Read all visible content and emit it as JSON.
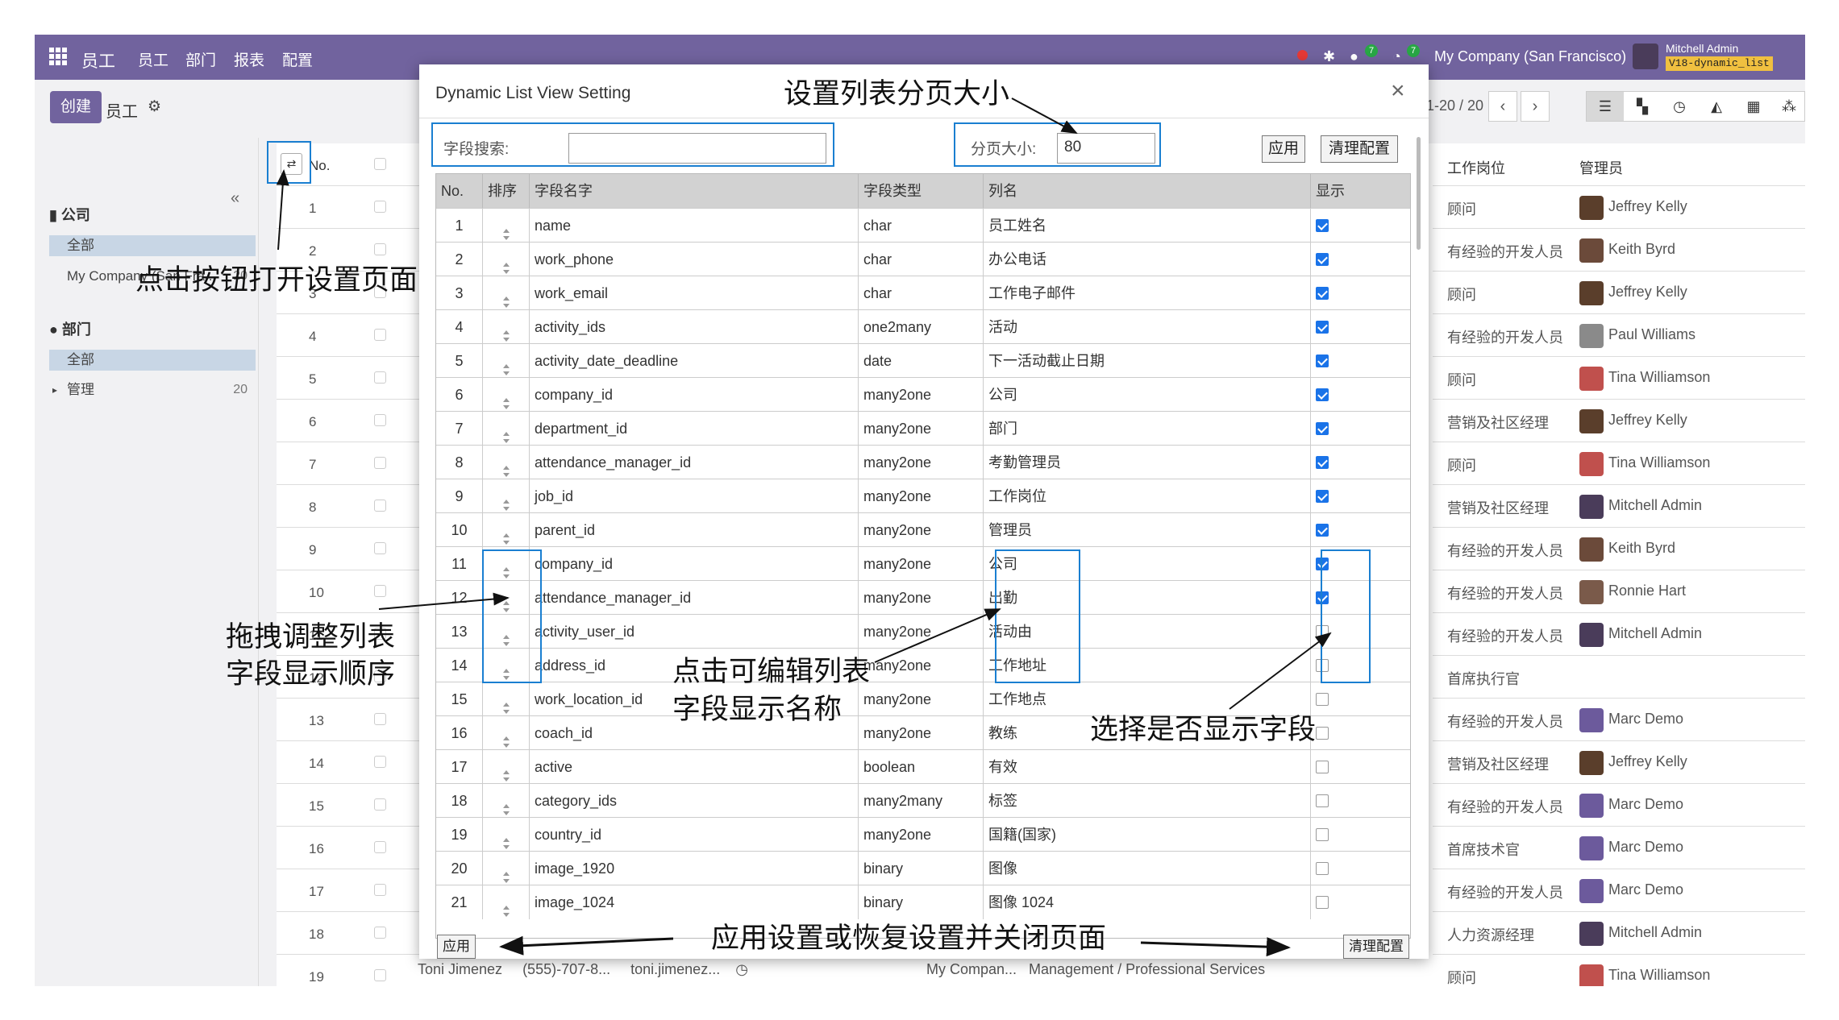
{
  "navbar": {
    "app_title": "员工",
    "menus": [
      "员工",
      "部门",
      "报表",
      "配置"
    ],
    "chat_badge": "7",
    "activity_badge": "7",
    "company": "My Company (San Francisco)",
    "user": "Mitchell Admin",
    "db": "V18-dynamic_list"
  },
  "control_panel": {
    "create_label": "创建",
    "breadcrumb": "员工",
    "pager": "1-20 / 20"
  },
  "sidepanel": {
    "company_head": "公司",
    "company_all": "全部",
    "company_item": "My Company (San Fra...",
    "company_count": "20",
    "dept_head": "部门",
    "dept_all": "全部",
    "dept_item": "管理",
    "dept_count": "20"
  },
  "list": {
    "no_header": "No.",
    "job_header": "工作岗位",
    "manager_header": "管理员",
    "row_numbers": [
      "1",
      "2",
      "3",
      "4",
      "5",
      "6",
      "7",
      "8",
      "9",
      "10",
      "11",
      "12",
      "13",
      "14",
      "15",
      "16",
      "17",
      "18",
      "19"
    ],
    "right_rows": [
      {
        "job": "顾问",
        "manager": "Jeffrey Kelly",
        "color": "#5a3e2b"
      },
      {
        "job": "有经验的开发人员",
        "manager": "Keith Byrd",
        "color": "#6b4a3a"
      },
      {
        "job": "顾问",
        "manager": "Jeffrey Kelly",
        "color": "#5a3e2b"
      },
      {
        "job": "有经验的开发人员",
        "manager": "Paul Williams",
        "color": "#8a8a8a"
      },
      {
        "job": "顾问",
        "manager": "Tina Williamson",
        "color": "#c0504d"
      },
      {
        "job": "营销及社区经理",
        "manager": "Jeffrey Kelly",
        "color": "#5a3e2b"
      },
      {
        "job": "顾问",
        "manager": "Tina Williamson",
        "color": "#c0504d"
      },
      {
        "job": "营销及社区经理",
        "manager": "Mitchell Admin",
        "color": "#4a3c5a"
      },
      {
        "job": "有经验的开发人员",
        "manager": "Keith Byrd",
        "color": "#6b4a3a"
      },
      {
        "job": "有经验的开发人员",
        "manager": "Ronnie Hart",
        "color": "#7a5a4a"
      },
      {
        "job": "有经验的开发人员",
        "manager": "Mitchell Admin",
        "color": "#4a3c5a"
      },
      {
        "job": "首席执行官",
        "manager": "",
        "color": ""
      },
      {
        "job": "有经验的开发人员",
        "manager": "Marc Demo",
        "color": "#6c5a9c"
      },
      {
        "job": "营销及社区经理",
        "manager": "Jeffrey Kelly",
        "color": "#5a3e2b"
      },
      {
        "job": "有经验的开发人员",
        "manager": "Marc Demo",
        "color": "#6c5a9c"
      },
      {
        "job": "首席技术官",
        "manager": "Marc Demo",
        "color": "#6c5a9c"
      },
      {
        "job": "有经验的开发人员",
        "manager": "Marc Demo",
        "color": "#6c5a9c"
      },
      {
        "job": "人力资源经理",
        "manager": "Mitchell Admin",
        "color": "#4a3c5a"
      },
      {
        "job": "顾问",
        "manager": "Tina Williamson",
        "color": "#c0504d"
      }
    ],
    "footer_row": {
      "name": "Toni Jimenez",
      "phone": "(555)-707-8...",
      "email": "toni.jimenez...",
      "company": "My Compan...",
      "dept": "Management / Professional Services"
    }
  },
  "modal": {
    "title": "Dynamic List View Setting",
    "search_label": "字段搜索:",
    "search_value": "",
    "page_size_label": "分页大小:",
    "page_size_value": "80",
    "apply_label": "应用",
    "reset_label": "清理配置",
    "headers": {
      "no": "No.",
      "sort": "排序",
      "field": "字段名字",
      "type": "字段类型",
      "column": "列名",
      "show": "显示"
    },
    "rows": [
      {
        "no": "1",
        "field": "name",
        "type": "char",
        "column": "员工姓名",
        "show": true
      },
      {
        "no": "2",
        "field": "work_phone",
        "type": "char",
        "column": "办公电话",
        "show": true
      },
      {
        "no": "3",
        "field": "work_email",
        "type": "char",
        "column": "工作电子邮件",
        "show": true
      },
      {
        "no": "4",
        "field": "activity_ids",
        "type": "one2many",
        "column": "活动",
        "show": true
      },
      {
        "no": "5",
        "field": "activity_date_deadline",
        "type": "date",
        "column": "下一活动截止日期",
        "show": true
      },
      {
        "no": "6",
        "field": "company_id",
        "type": "many2one",
        "column": "公司",
        "show": true
      },
      {
        "no": "7",
        "field": "department_id",
        "type": "many2one",
        "column": "部门",
        "show": true
      },
      {
        "no": "8",
        "field": "attendance_manager_id",
        "type": "many2one",
        "column": "考勤管理员",
        "show": true
      },
      {
        "no": "9",
        "field": "job_id",
        "type": "many2one",
        "column": "工作岗位",
        "show": true
      },
      {
        "no": "10",
        "field": "parent_id",
        "type": "many2one",
        "column": "管理员",
        "show": true
      },
      {
        "no": "11",
        "field": "company_id",
        "type": "many2one",
        "column": "公司",
        "show": true
      },
      {
        "no": "12",
        "field": "attendance_manager_id",
        "type": "many2one",
        "column": "出勤",
        "show": true
      },
      {
        "no": "13",
        "field": "activity_user_id",
        "type": "many2one",
        "column": "活动由",
        "show": false
      },
      {
        "no": "14",
        "field": "address_id",
        "type": "many2one",
        "column": "工作地址",
        "show": false
      },
      {
        "no": "15",
        "field": "work_location_id",
        "type": "many2one",
        "column": "工作地点",
        "show": false
      },
      {
        "no": "16",
        "field": "coach_id",
        "type": "many2one",
        "column": "教练",
        "show": false
      },
      {
        "no": "17",
        "field": "active",
        "type": "boolean",
        "column": "有效",
        "show": false
      },
      {
        "no": "18",
        "field": "category_ids",
        "type": "many2many",
        "column": "标签",
        "show": false
      },
      {
        "no": "19",
        "field": "country_id",
        "type": "many2one",
        "column": "国籍(国家)",
        "show": false
      },
      {
        "no": "20",
        "field": "image_1920",
        "type": "binary",
        "column": "图像",
        "show": false
      },
      {
        "no": "21",
        "field": "image_1024",
        "type": "binary",
        "column": "图像 1024",
        "show": false
      }
    ]
  },
  "annotations": {
    "page_size": "设置列表分页大小",
    "open_button": "点击按钮打开设置页面",
    "drag_line1": "拖拽调整列表",
    "drag_line2": "字段显示顺序",
    "edit_line1": "点击可编辑列表",
    "edit_line2": "字段显示名称",
    "toggle": "选择是否显示字段",
    "apply_reset": "应用设置或恢复设置并关闭页面"
  },
  "colors": {
    "brand": "#71639e",
    "highlight": "#1a7fd1",
    "checkbox": "#1a73e8"
  }
}
